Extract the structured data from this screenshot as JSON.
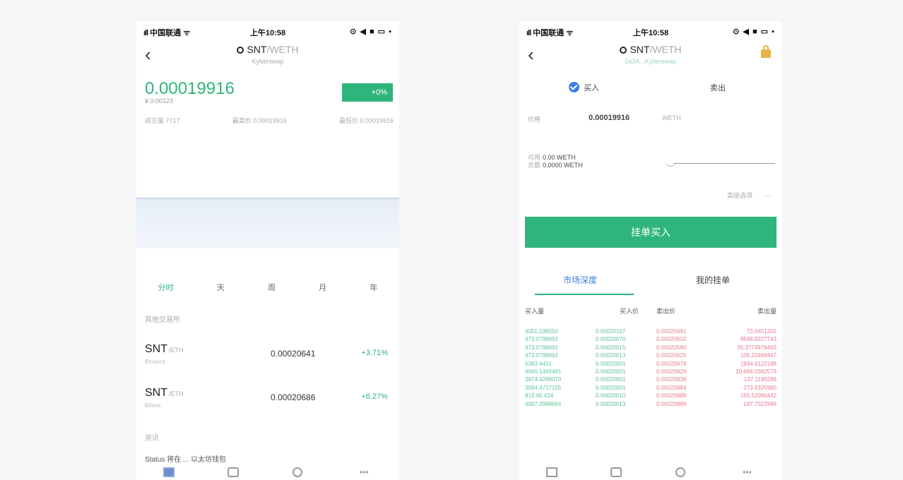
{
  "left": {
    "status": {
      "carrier": "中国联通",
      "time": "上午10:58",
      "battery": "■"
    },
    "nav": {
      "base": "SNT",
      "quote": "/WETH",
      "subtitle": "Kyberswap"
    },
    "price": "0.00019916",
    "price_sub": "¥ 0.00123",
    "change": "+0%",
    "stats": {
      "volume": "成交量 7717",
      "high": "最高价 0.00019916",
      "low": "最低价 0.00019916"
    },
    "periods": [
      {
        "label": "分时",
        "active": true
      },
      {
        "label": "天",
        "active": false
      },
      {
        "label": "周",
        "active": false
      },
      {
        "label": "月",
        "active": false
      },
      {
        "label": "年",
        "active": false
      }
    ],
    "other_markets_label": "其他交易所",
    "markets": [
      {
        "symbol": "SNT",
        "quote": "/ETH",
        "exchange": "Binance",
        "price": "0.00020641",
        "change": "+3.71%"
      },
      {
        "symbol": "SNT",
        "quote": "/ETH",
        "exchange": "Bittrex",
        "price": "0.00020686",
        "change": "+6.27%"
      }
    ],
    "news_label": "资讯",
    "news_preview": "Status 将在 ... 以太坊钱包"
  },
  "right": {
    "status": {
      "carrier": "中国联通",
      "time": "上午10:58",
      "battery": "■"
    },
    "nav": {
      "base": "SNT",
      "quote": "/WETH",
      "subtitle": "0x3A...Kyberswap"
    },
    "sides": {
      "buy": "买入",
      "sell": "卖出"
    },
    "price_row": {
      "label": "价格",
      "value": "0.00019916",
      "unit": "WETH"
    },
    "balance": {
      "available_label": "可用",
      "available": "0.00 WETH",
      "total_label": "总额",
      "total": "0.0000 WETH"
    },
    "advanced_label": "高级选项",
    "advanced_dots": "···",
    "buy_button": "挂单买入",
    "orders_tabs": [
      {
        "label": "市场深度",
        "active": true
      },
      {
        "label": "我的挂单",
        "active": false
      }
    ],
    "orderbook_header": {
      "bid_amount": "买入量",
      "bid_price": "买入价",
      "ask_price": "卖出价",
      "ask_amount": "卖出量"
    },
    "orderbook": [
      {
        "bid_amount": "4051.038550",
        "bid_price": "0.00020107",
        "ask_price": "0.00020491",
        "ask_amount": "73.0451201"
      },
      {
        "bid_amount": "473.0798693",
        "bid_price": "0.00020070",
        "ask_price": "0.00020502",
        "ask_amount": "8648.8227743"
      },
      {
        "bid_amount": "473.0798693",
        "bid_price": "0.00020015",
        "ask_price": "0.00020580",
        "ask_amount": "35.3774978463"
      },
      {
        "bid_amount": "473.0798693",
        "bid_price": "0.00020013",
        "ask_price": "0.00020625",
        "ask_amount": "105.22469447"
      },
      {
        "bid_amount": "5383.4431",
        "bid_price": "0.00020001",
        "ask_price": "0.00020678",
        "ask_amount": "1934.6122186"
      },
      {
        "bid_amount": "4560.1460491",
        "bid_price": "0.00020001",
        "ask_price": "0.00020929",
        "ask_amount": "10.686.0382579"
      },
      {
        "bid_amount": "3974.4288070",
        "bid_price": "0.00020001",
        "ask_price": "0.00020938",
        "ask_amount": "137.1190286"
      },
      {
        "bid_amount": "3094.4727155",
        "bid_price": "0.00020001",
        "ask_price": "0.00020984",
        "ask_amount": "273.6325960"
      },
      {
        "bid_amount": "819.66.424",
        "bid_price": "0.00020010",
        "ask_price": "0.00020988",
        "ask_amount": "155.52080442"
      },
      {
        "bid_amount": "4087.3988664",
        "bid_price": "0.00020013",
        "ask_price": "0.00020989",
        "ask_amount": "187.7022996"
      }
    ]
  },
  "colors": {
    "accent_green": "#2fb57b",
    "accent_blue": "#3b7de0",
    "ask_red": "#e57a8e"
  }
}
